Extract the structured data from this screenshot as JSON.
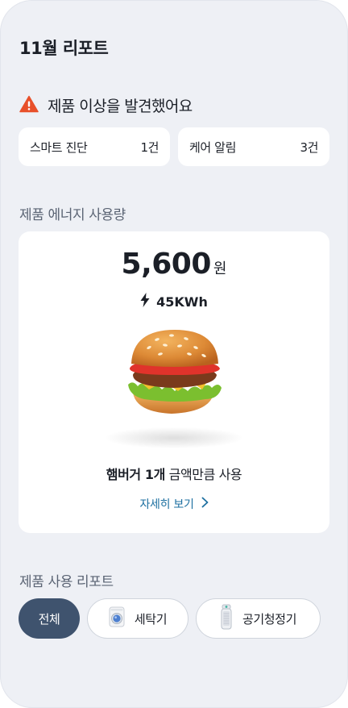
{
  "report": {
    "title": "11월 리포트"
  },
  "alert": {
    "message": "제품 이상을 발견했어요"
  },
  "summary": [
    {
      "label": "스마트 진단",
      "count": "1건"
    },
    {
      "label": "케어 알림",
      "count": "3건"
    }
  ],
  "energy": {
    "section_title": "제품 에너지 사용량",
    "amount": "5,600",
    "unit": "원",
    "kwh": "45KWh",
    "usage_bold": "햄버거 1개",
    "usage_rest": " 금액만큼 사용",
    "detail_link": "자세히 보기"
  },
  "usage_report": {
    "section_title": "제품 사용 리포트",
    "chips": [
      {
        "label": "전체",
        "active": true
      },
      {
        "label": "세탁기",
        "icon": "washing-machine-icon"
      },
      {
        "label": "공기청정기",
        "icon": "air-purifier-icon"
      }
    ]
  },
  "colors": {
    "background": "#eef0f5",
    "active_chip": "#3f536e",
    "link": "#1c6fa0",
    "warning": "#e8502a"
  }
}
